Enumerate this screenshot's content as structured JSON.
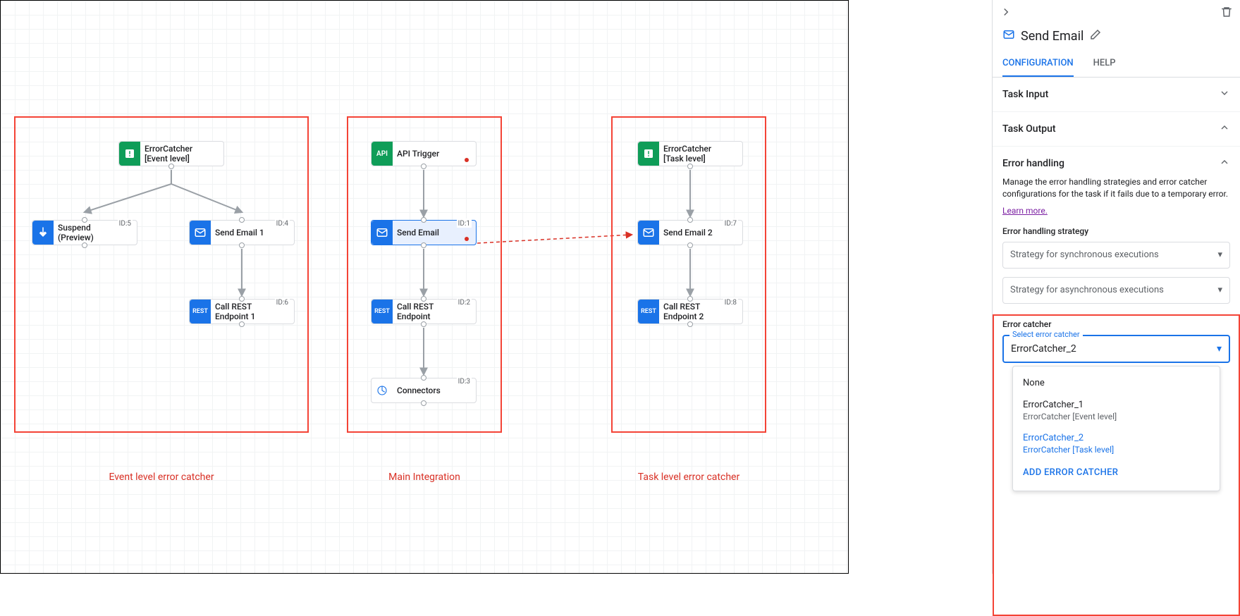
{
  "canvas": {
    "groups": [
      {
        "label": "Event level error catcher"
      },
      {
        "label": "Main Integration"
      },
      {
        "label": "Task level error catcher"
      }
    ],
    "nodes": {
      "ec_event": {
        "line1": "ErrorCatcher",
        "line2": "[Event level]"
      },
      "suspend": {
        "line1": "Suspend",
        "line2": "(Preview)",
        "id": "ID:5"
      },
      "sendemail1": {
        "label": "Send Email 1",
        "id": "ID:4"
      },
      "callrest1": {
        "line1": "Call REST",
        "line2": "Endpoint 1",
        "id": "ID:6"
      },
      "apitrigger": {
        "label": "API Trigger"
      },
      "sendemail": {
        "label": "Send Email",
        "id": "ID:1"
      },
      "callrest": {
        "line1": "Call REST",
        "line2": "Endpoint",
        "id": "ID:2"
      },
      "connectors": {
        "label": "Connectors",
        "id": "ID:3"
      },
      "ec_task": {
        "line1": "ErrorCatcher",
        "line2": "[Task level]"
      },
      "sendemail2": {
        "label": "Send Email 2",
        "id": "ID:7"
      },
      "callrest2": {
        "line1": "Call REST",
        "line2": "Endpoint 2",
        "id": "ID:8"
      }
    },
    "icons": {
      "api": "API",
      "rest": "REST"
    }
  },
  "panel": {
    "title": "Send Email",
    "tabs": {
      "config": "CONFIGURATION",
      "help": "HELP"
    },
    "sections": {
      "taskInput": "Task Input",
      "taskOutput": "Task Output",
      "errorHandling": {
        "title": "Error handling",
        "desc": "Manage the error handling strategies and error catcher configurations for the task if it fails due to a temporary error.",
        "learn": "Learn more.",
        "strategyLabel": "Error handling strategy",
        "syncPlaceholder": "Strategy for synchronous executions",
        "asyncPlaceholder": "Strategy for asynchronous executions",
        "catcherLabel": "Error catcher",
        "selectLegend": "Select error catcher",
        "selectedValue": "ErrorCatcher_2",
        "options": [
          {
            "main": "None"
          },
          {
            "main": "ErrorCatcher_1",
            "sub": "ErrorCatcher [Event level]"
          },
          {
            "main": "ErrorCatcher_2",
            "sub": "ErrorCatcher [Task level]",
            "selected": true
          }
        ],
        "addLabel": "ADD ERROR CATCHER"
      }
    }
  }
}
